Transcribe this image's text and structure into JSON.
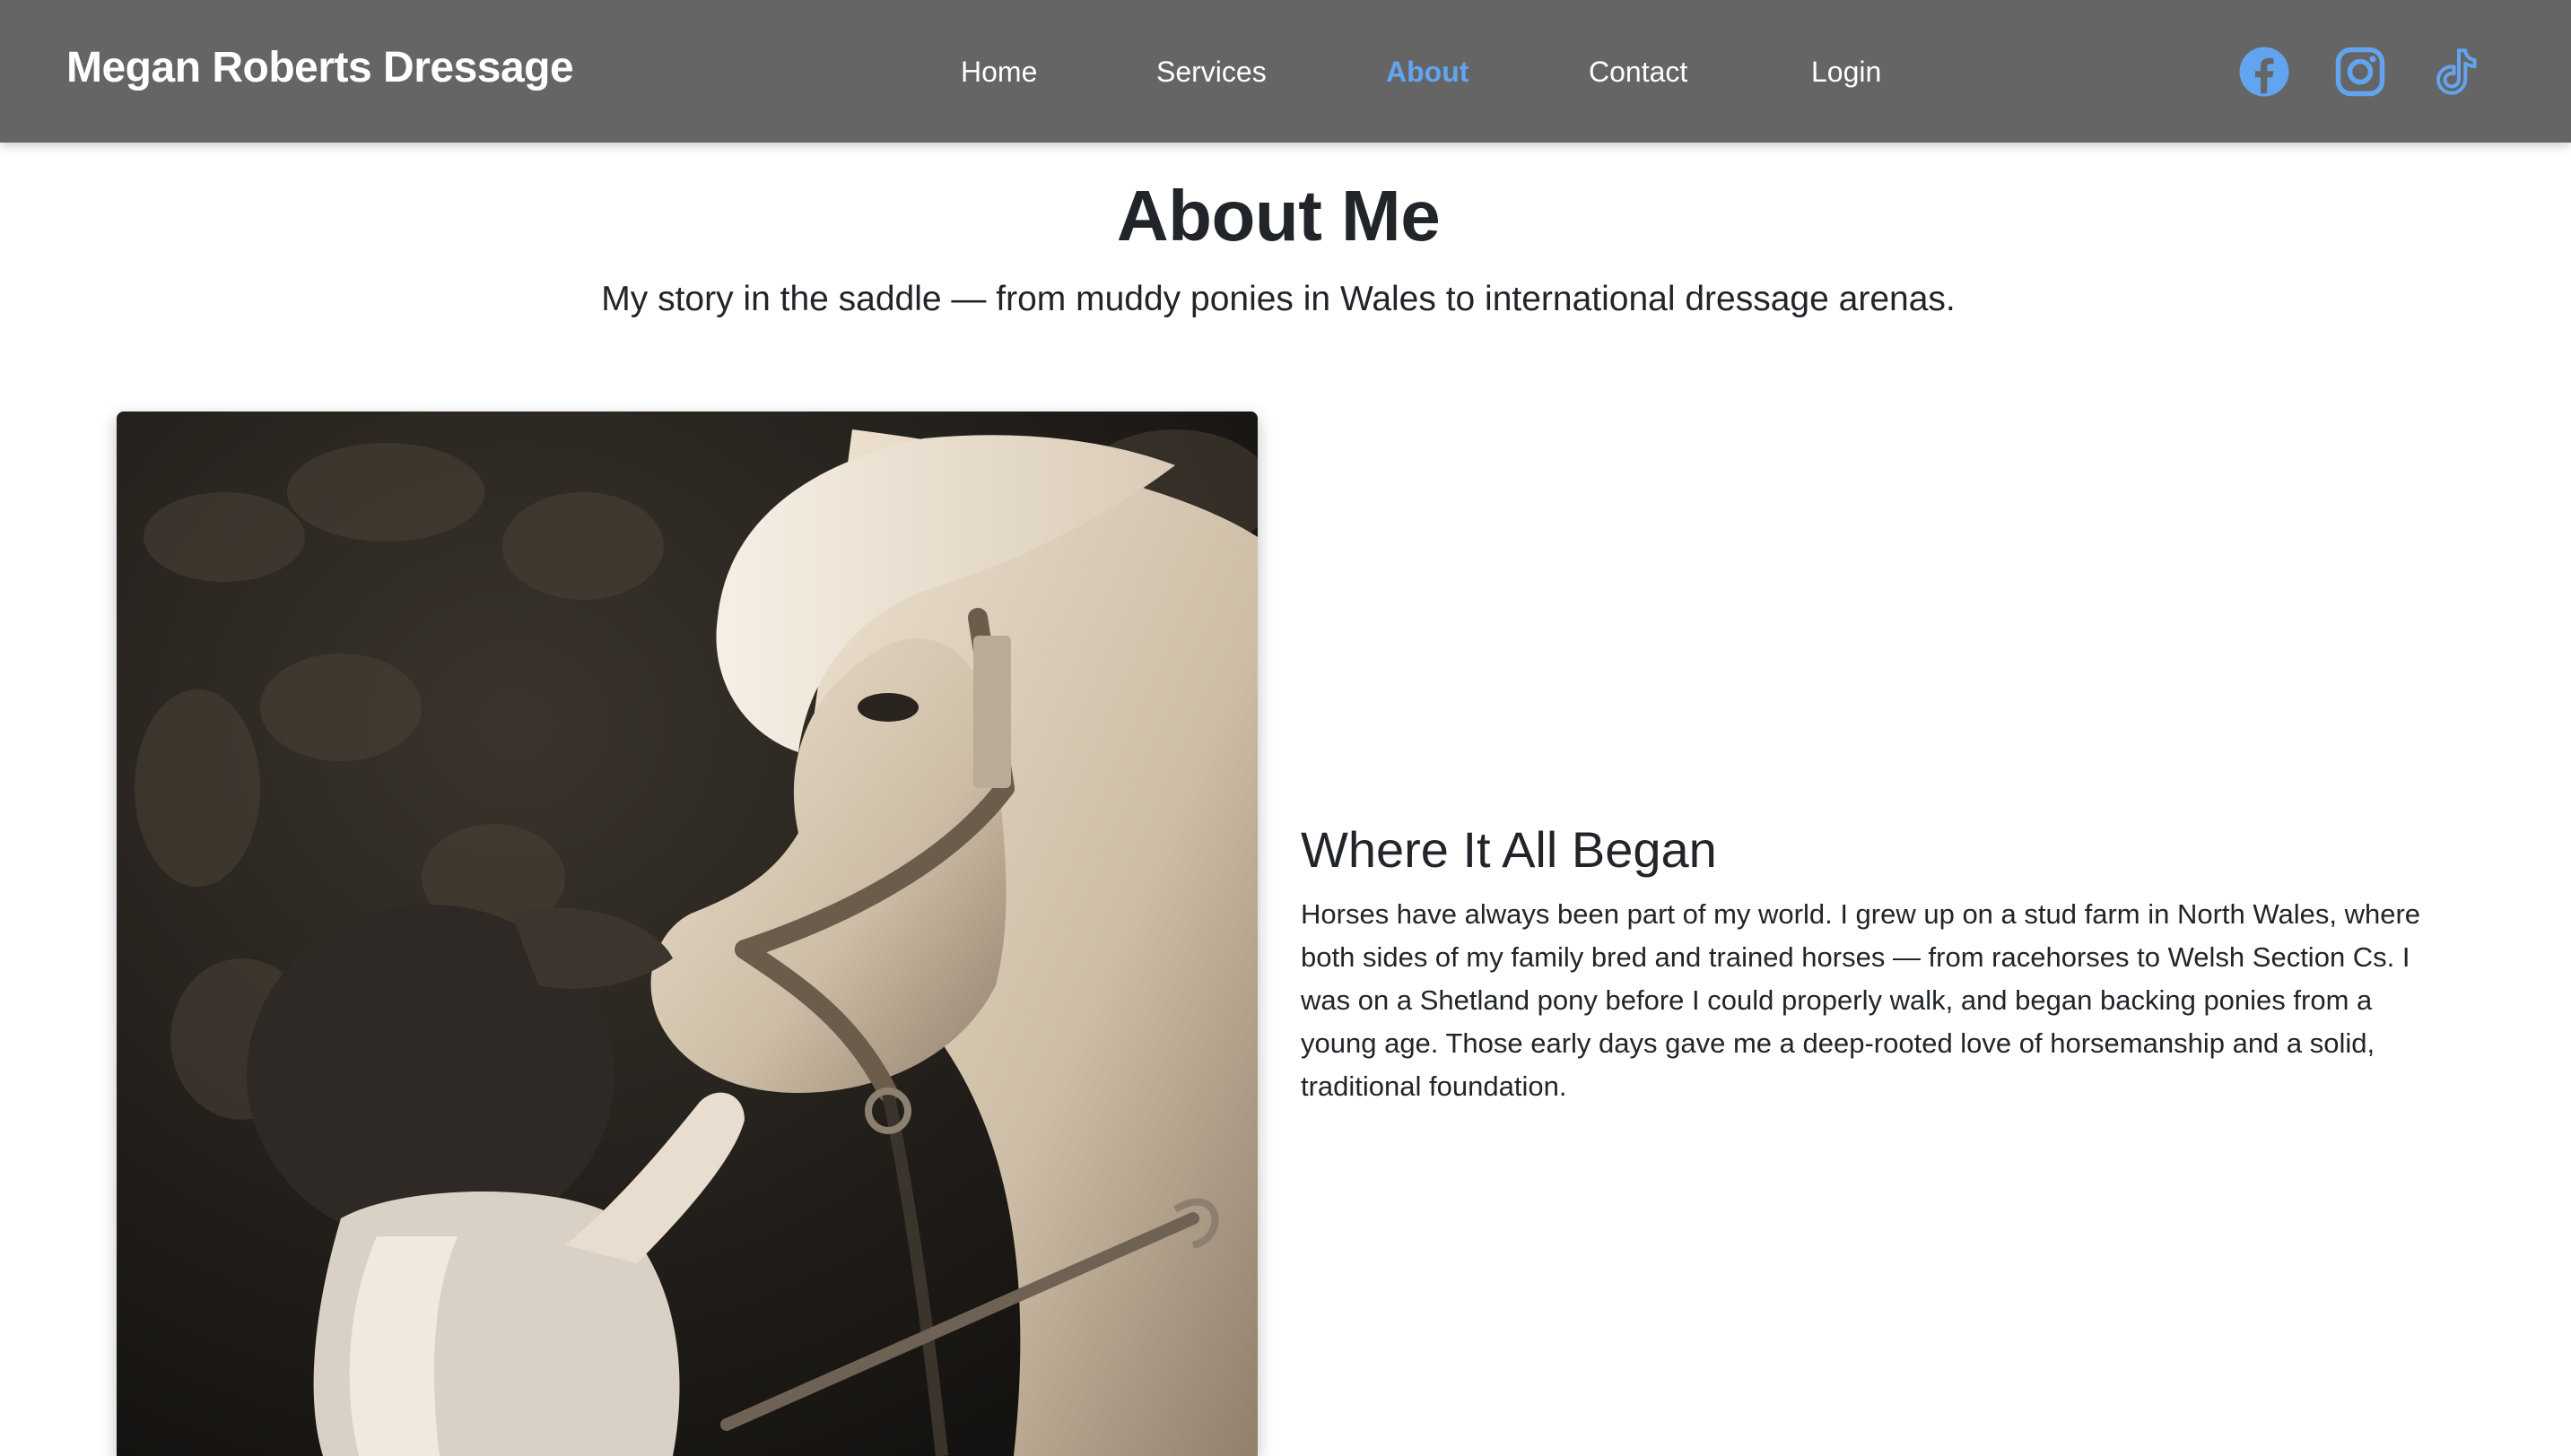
{
  "navbar": {
    "brand": "Megan Roberts Dressage",
    "links": [
      {
        "label": "Home",
        "active": false
      },
      {
        "label": "Services",
        "active": false
      },
      {
        "label": "About",
        "active": true
      },
      {
        "label": "Contact",
        "active": false
      },
      {
        "label": "Login",
        "active": false
      }
    ],
    "social_icons": [
      "facebook-icon",
      "instagram-icon",
      "tiktok-icon"
    ],
    "accent_color": "#63a4f0",
    "background_color": "#656565"
  },
  "hero": {
    "title": "About Me",
    "subtitle": "My story in the saddle — from muddy ponies in Wales to international dressage arenas."
  },
  "section": {
    "title": "Where It All Began",
    "body": "Horses have always been part of my world. I grew up on a stud farm in North Wales, where both sides of my family bred and trained horses — from racehorses to Welsh Section Cs. I was on a Shetland pony before I could properly walk, and began backing ponies from a young age. Those early days gave me a deep-rooted love of horsemanship and a solid, traditional foundation."
  },
  "photo": {
    "subject": "child-with-pony-photo"
  }
}
